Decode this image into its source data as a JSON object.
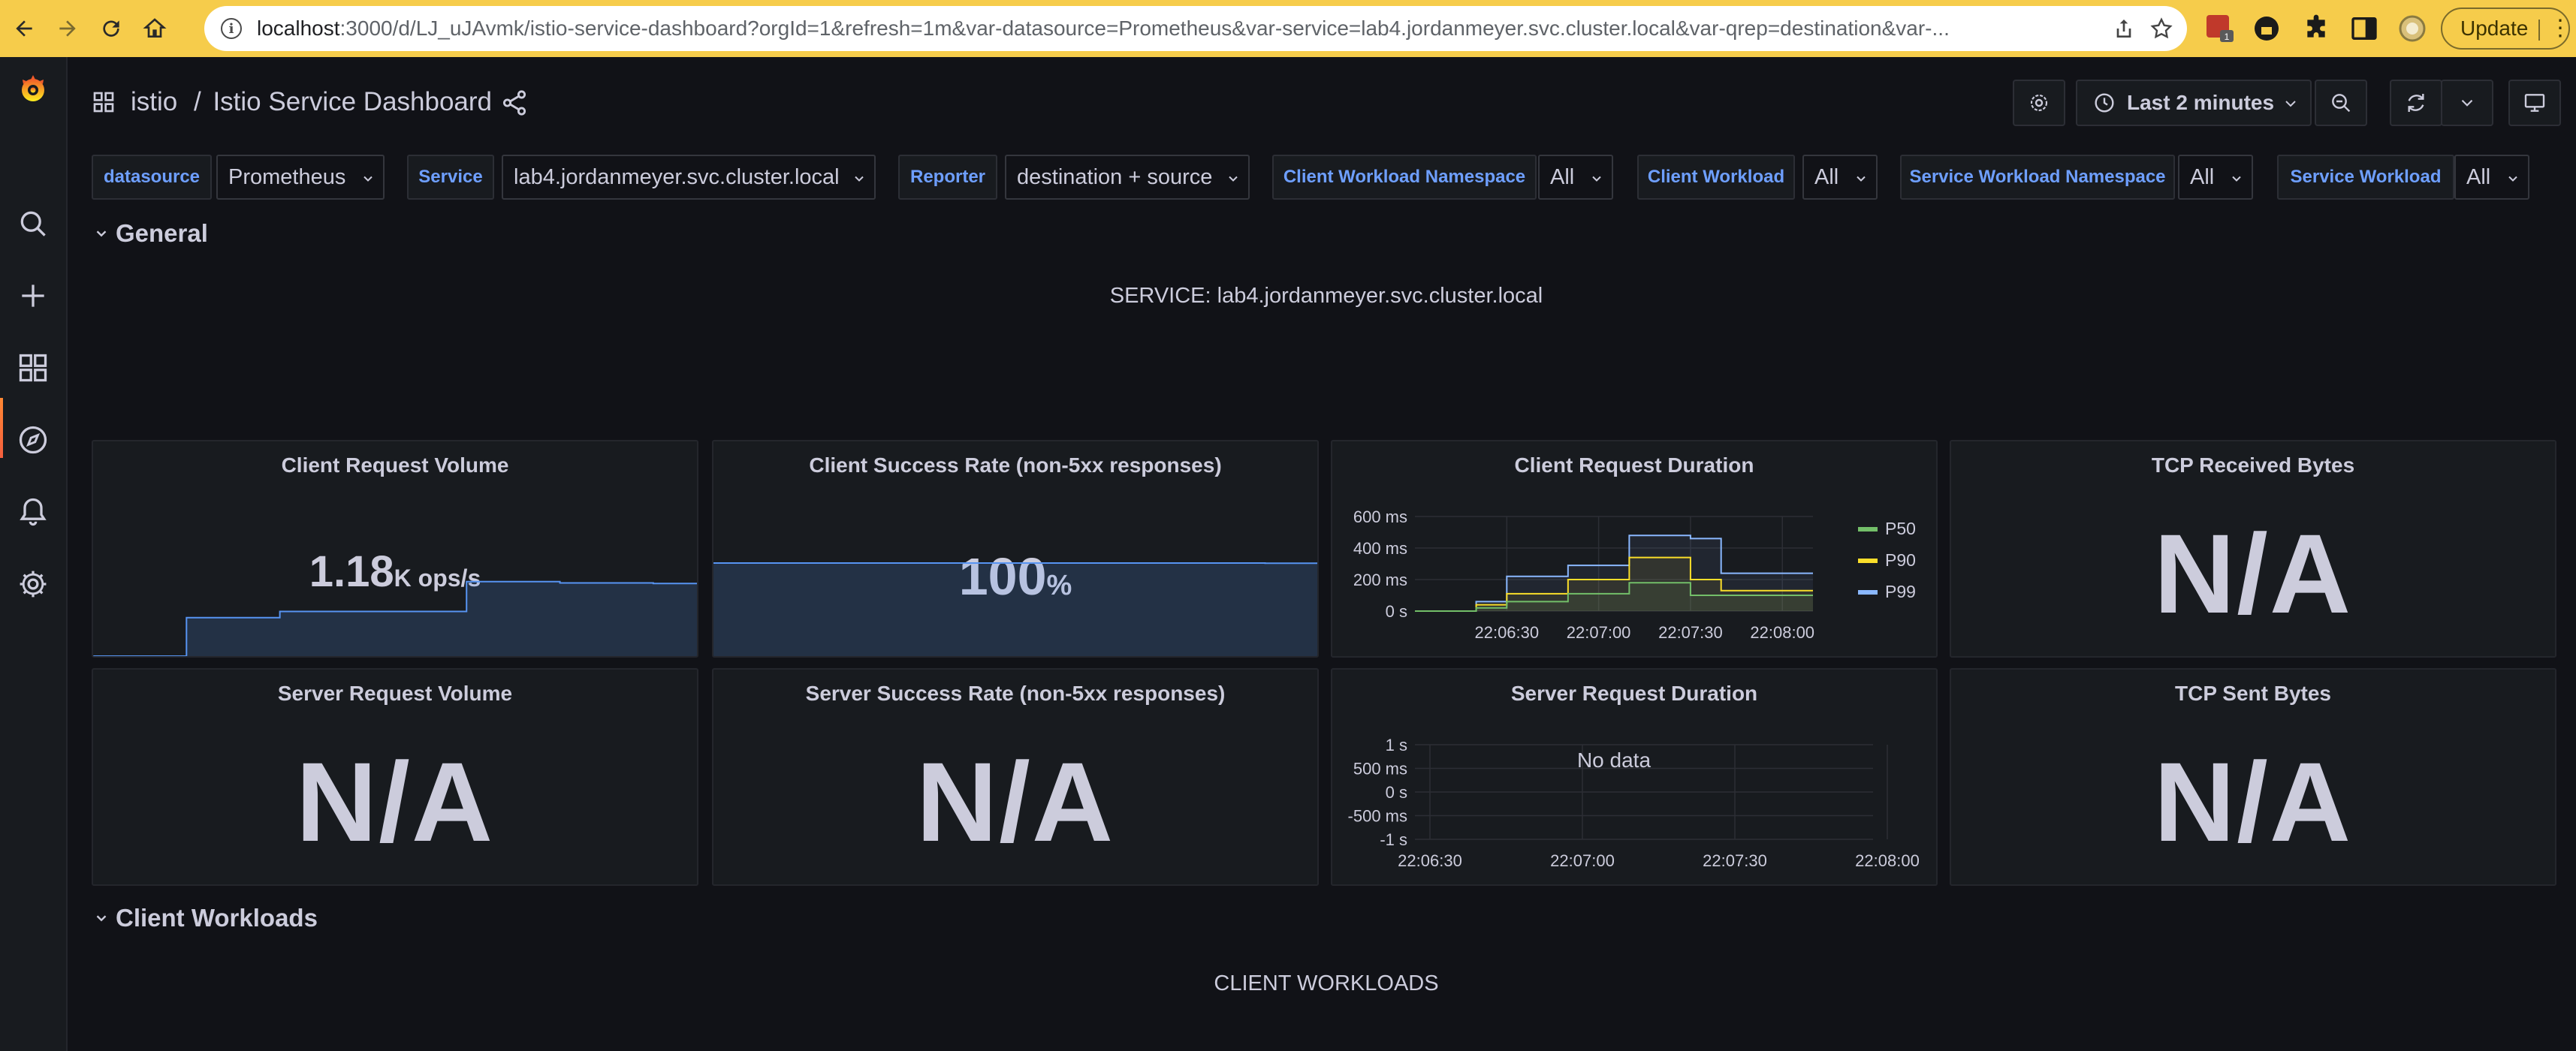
{
  "browser": {
    "url_host": "localhost",
    "url_rest": ":3000/d/LJ_uJAvmk/istio-service-dashboard?orgId=1&refresh=1m&var-datasource=Prometheus&var-service=lab4.jordanmeyer.svc.cluster.local&var-qrep=destination&var-...",
    "ext_badge": "1",
    "update_label": "Update"
  },
  "breadcrumb": {
    "folder": "istio",
    "separator": "/",
    "title": "Istio Service Dashboard"
  },
  "toolbar": {
    "time_range": "Last 2 minutes"
  },
  "variables": [
    {
      "label": "datasource",
      "value": "Prometheus"
    },
    {
      "label": "Service",
      "value": "lab4.jordanmeyer.svc.cluster.local"
    },
    {
      "label": "Reporter",
      "value": "destination + source"
    },
    {
      "label": "Client Workload Namespace",
      "value": "All"
    },
    {
      "label": "Client Workload",
      "value": "All"
    },
    {
      "label": "Service Workload Namespace",
      "value": "All"
    },
    {
      "label": "Service Workload",
      "value": "All"
    }
  ],
  "rows": {
    "general": "General",
    "client_workloads": "Client Workloads"
  },
  "text_panels": {
    "service": "SERVICE: lab4.jordanmeyer.svc.cluster.local",
    "client_workloads": "CLIENT WORKLOADS"
  },
  "panels": {
    "client_request_volume": {
      "title": "Client Request Volume",
      "value": "1.18",
      "unit": "K ops/s"
    },
    "client_success_rate": {
      "title": "Client Success Rate (non-5xx responses)",
      "value": "100",
      "unit": "%"
    },
    "client_request_duration": {
      "title": "Client Request Duration"
    },
    "tcp_received_bytes": {
      "title": "TCP Received Bytes",
      "value": "N/A"
    },
    "server_request_volume": {
      "title": "Server Request Volume",
      "value": "N/A"
    },
    "server_success_rate": {
      "title": "Server Success Rate (non-5xx responses)",
      "value": "N/A"
    },
    "server_request_duration": {
      "title": "Server Request Duration",
      "no_data": "No data"
    },
    "tcp_sent_bytes": {
      "title": "TCP Sent Bytes",
      "value": "N/A"
    }
  },
  "chart_data": [
    {
      "type": "line",
      "title": "Client Request Duration",
      "x": [
        "22:06:00",
        "22:06:10",
        "22:06:20",
        "22:06:30",
        "22:06:40",
        "22:06:50",
        "22:07:00",
        "22:07:10",
        "22:07:20",
        "22:07:30",
        "22:07:40",
        "22:07:50",
        "22:08:00",
        "22:08:10"
      ],
      "x_ticks": [
        "22:06:30",
        "22:07:00",
        "22:07:30",
        "22:08:00"
      ],
      "y_ticks": [
        "0 s",
        "200 ms",
        "400 ms",
        "600 ms"
      ],
      "ylim": [
        0,
        600
      ],
      "series": [
        {
          "name": "P50",
          "color": "#73bf69",
          "values": [
            0,
            0,
            20,
            60,
            60,
            110,
            110,
            180,
            180,
            100,
            100,
            100,
            100,
            100
          ]
        },
        {
          "name": "P90",
          "color": "#fade2a",
          "values": [
            0,
            0,
            40,
            110,
            110,
            200,
            200,
            340,
            340,
            200,
            130,
            130,
            130,
            130
          ]
        },
        {
          "name": "P99",
          "color": "#8ab8ff",
          "values": [
            0,
            0,
            60,
            220,
            220,
            290,
            290,
            480,
            480,
            460,
            240,
            240,
            240,
            240
          ]
        }
      ],
      "legend": "right"
    },
    {
      "type": "line",
      "title": "Server Request Duration",
      "x_ticks": [
        "22:06:30",
        "22:07:00",
        "22:07:30",
        "22:08:00"
      ],
      "y_ticks": [
        "-1 s",
        "-500 ms",
        "0 s",
        "500 ms",
        "1 s"
      ],
      "ylim": [
        -1,
        1
      ],
      "series": []
    },
    {
      "type": "area",
      "title": "Client Request Volume",
      "values": [
        0,
        0,
        0.62,
        0.62,
        0.72,
        0.72,
        0.72,
        0.72,
        1.2,
        1.2,
        1.18,
        1.18,
        1.17,
        1.17
      ],
      "ylim": [
        0,
        1.5
      ]
    },
    {
      "type": "area",
      "title": "Client Success Rate (non-5xx responses)",
      "values": [
        100,
        100,
        100,
        100,
        100,
        100,
        100,
        100,
        100,
        100,
        99.8,
        100
      ],
      "ylim": [
        0,
        100
      ]
    }
  ],
  "colors": {
    "accent": "#ff8833",
    "link_blue": "#6e9fff",
    "bg": "#111217",
    "panel": "#181b1f"
  }
}
